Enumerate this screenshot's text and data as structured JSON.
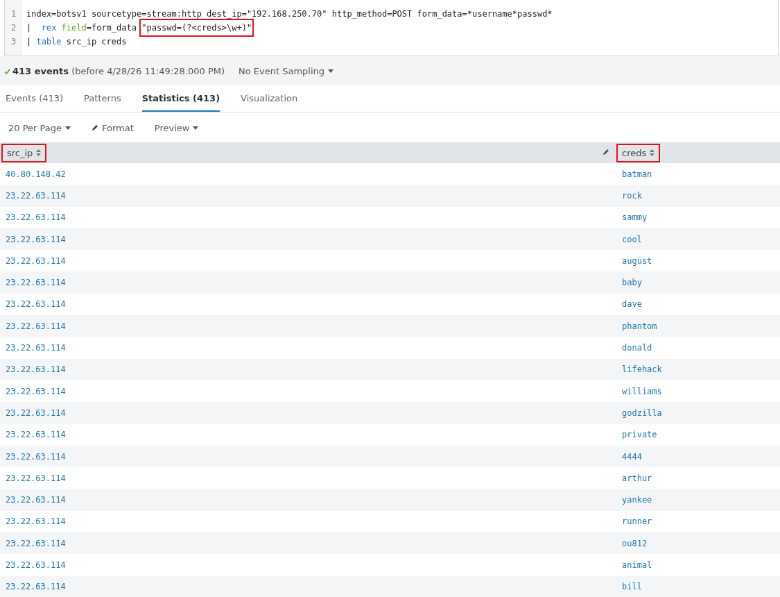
{
  "query": {
    "lines": [
      {
        "number": "1",
        "tokens": [
          {
            "kind": "plain",
            "text": "index=botsv1 sourcetype=stream:http dest_ip=\"192.168.250.70\" http_method=POST form_data=*username*passwd*",
            "highlighted": false
          }
        ]
      },
      {
        "number": "2",
        "tokens": [
          {
            "kind": "plain",
            "text": "|  ",
            "highlighted": false
          },
          {
            "kind": "command",
            "text": "rex",
            "highlighted": false
          },
          {
            "kind": "argument",
            "text": "field",
            "highlighted": false
          },
          {
            "kind": "plain",
            "text": "=form_data ",
            "highlighted": false
          },
          {
            "kind": "plain",
            "text": "\"passwd=(?<creds>\\w+)\"",
            "highlighted": true
          }
        ]
      },
      {
        "number": "3",
        "tokens": [
          {
            "kind": "plain",
            "text": "| ",
            "highlighted": false
          },
          {
            "kind": "command",
            "text": "table",
            "highlighted": false
          },
          {
            "kind": "plain",
            "text": "src_ip creds",
            "highlighted": false
          }
        ]
      }
    ]
  },
  "status": {
    "count": "413 events",
    "detail": "(before 4/28/26 11:49:28.000 PM)",
    "sampling": "No Event Sampling"
  },
  "tabs": [
    {
      "label": "Events (413)",
      "selected": false
    },
    {
      "label": "Patterns",
      "selected": false
    },
    {
      "label": "Statistics (413)",
      "selected": true
    },
    {
      "label": "Visualization",
      "selected": false
    }
  ],
  "toolbar": {
    "per_page": "20 Per Page",
    "format": "Format",
    "preview": "Preview"
  },
  "table": {
    "columns": [
      {
        "label": "src_ip",
        "highlighted": true
      },
      {
        "label": "creds",
        "highlighted": true
      }
    ],
    "rows": [
      [
        "40.80.148.42",
        "batman"
      ],
      [
        "23.22.63.114",
        "rock"
      ],
      [
        "23.22.63.114",
        "sammy"
      ],
      [
        "23.22.63.114",
        "cool"
      ],
      [
        "23.22.63.114",
        "august"
      ],
      [
        "23.22.63.114",
        "baby"
      ],
      [
        "23.22.63.114",
        "dave"
      ],
      [
        "23.22.63.114",
        "phantom"
      ],
      [
        "23.22.63.114",
        "donald"
      ],
      [
        "23.22.63.114",
        "lifehack"
      ],
      [
        "23.22.63.114",
        "williams"
      ],
      [
        "23.22.63.114",
        "godzilla"
      ],
      [
        "23.22.63.114",
        "private"
      ],
      [
        "23.22.63.114",
        "4444"
      ],
      [
        "23.22.63.114",
        "arthur"
      ],
      [
        "23.22.63.114",
        "yankee"
      ],
      [
        "23.22.63.114",
        "runner"
      ],
      [
        "23.22.63.114",
        "ou812"
      ],
      [
        "23.22.63.114",
        "animal"
      ],
      [
        "23.22.63.114",
        "bill"
      ]
    ]
  }
}
